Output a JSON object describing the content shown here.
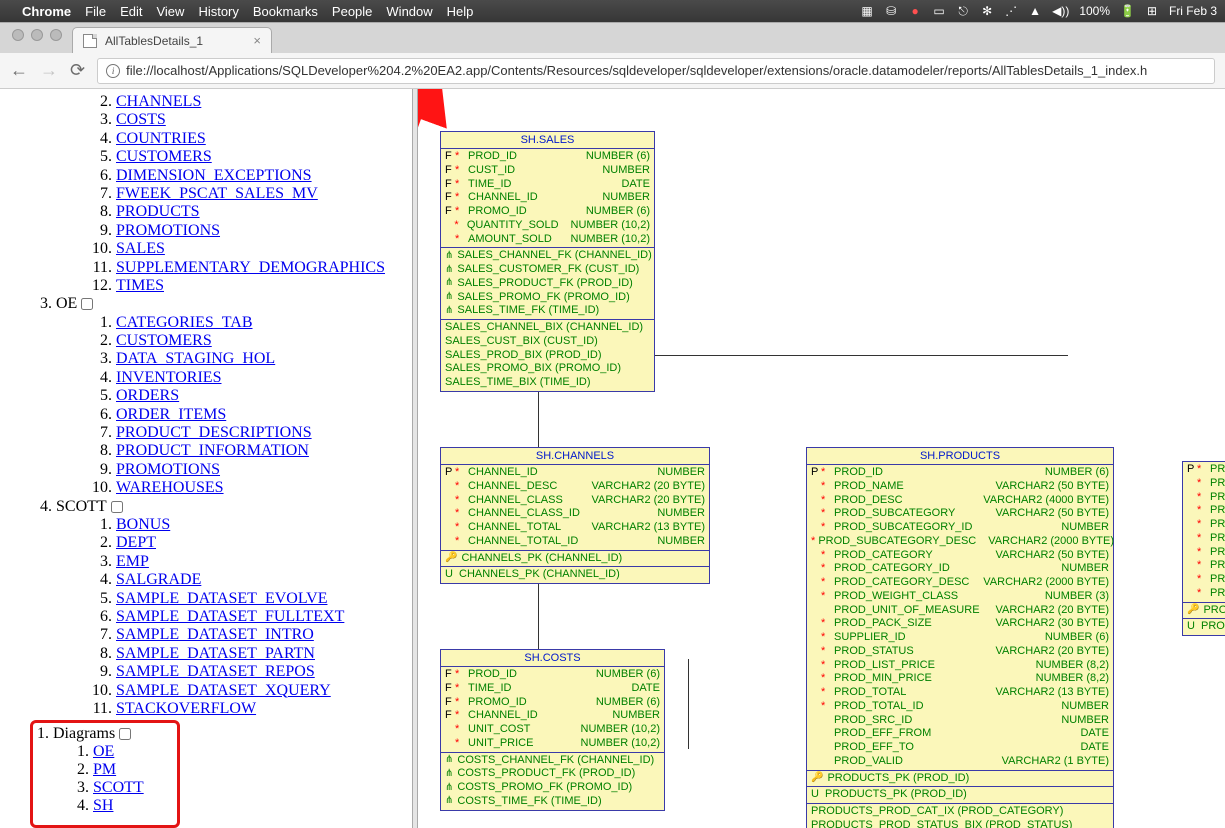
{
  "menubar": {
    "app": "Chrome",
    "items": [
      "File",
      "Edit",
      "View",
      "History",
      "Bookmarks",
      "People",
      "Window",
      "Help"
    ],
    "right": {
      "battery": "100%",
      "battery_icon": "⚡",
      "date": "Fri Feb 3",
      "sound": "◀))"
    }
  },
  "tab": {
    "title": "AllTablesDetails_1"
  },
  "url": "file://localhost/Applications/SQLDeveloper%204.2%20EA2.app/Contents/Resources/sqldeveloper/sqldeveloper/extensions/oracle.datamodeler/reports/AllTablesDetails_1_index.h",
  "nav": {
    "start_index": 2,
    "first_items": [
      "CHANNELS",
      "COSTS",
      "COUNTRIES",
      "CUSTOMERS",
      "DIMENSION_EXCEPTIONS",
      "FWEEK_PSCAT_SALES_MV",
      "PRODUCTS",
      "PROMOTIONS",
      "SALES",
      "SUPPLEMENTARY_DEMOGRAPHICS",
      "TIMES"
    ],
    "schemas": [
      {
        "num": "3",
        "name": "OE",
        "items": [
          "CATEGORIES_TAB",
          "CUSTOMERS",
          "DATA_STAGING_HOL",
          "INVENTORIES",
          "ORDERS",
          "ORDER_ITEMS",
          "PRODUCT_DESCRIPTIONS",
          "PRODUCT_INFORMATION",
          "PROMOTIONS",
          "WAREHOUSES"
        ]
      },
      {
        "num": "4",
        "name": "SCOTT",
        "items": [
          "BONUS",
          "DEPT",
          "EMP",
          "SALGRADE",
          "SAMPLE_DATASET_EVOLVE",
          "SAMPLE_DATASET_FULLTEXT",
          "SAMPLE_DATASET_INTRO",
          "SAMPLE_DATASET_PARTN",
          "SAMPLE_DATASET_REPOS",
          "SAMPLE_DATASET_XQUERY",
          "STACKOVERFLOW"
        ]
      }
    ],
    "diagrams": {
      "label": "Diagrams",
      "items": [
        "OE",
        "PM",
        "SCOTT",
        "SH"
      ]
    }
  },
  "diagram": {
    "label": "SH",
    "tables": {
      "sales": {
        "title": "SH.SALES",
        "cols": [
          {
            "f": "F",
            "s": "*",
            "n": "PROD_ID",
            "t": "NUMBER (6)"
          },
          {
            "f": "F",
            "s": "*",
            "n": "CUST_ID",
            "t": "NUMBER"
          },
          {
            "f": "F",
            "s": "*",
            "n": "TIME_ID",
            "t": "DATE"
          },
          {
            "f": "F",
            "s": "*",
            "n": "CHANNEL_ID",
            "t": "NUMBER"
          },
          {
            "f": "F",
            "s": "*",
            "n": "PROMO_ID",
            "t": "NUMBER (6)"
          },
          {
            "f": "",
            "s": "*",
            "n": "QUANTITY_SOLD",
            "t": "NUMBER (10,2)"
          },
          {
            "f": "",
            "s": "*",
            "n": "AMOUNT_SOLD",
            "t": "NUMBER (10,2)"
          }
        ],
        "fks": [
          "SALES_CHANNEL_FK (CHANNEL_ID)",
          "SALES_CUSTOMER_FK (CUST_ID)",
          "SALES_PRODUCT_FK (PROD_ID)",
          "SALES_PROMO_FK (PROMO_ID)",
          "SALES_TIME_FK (TIME_ID)"
        ],
        "idx": [
          "SALES_CHANNEL_BIX (CHANNEL_ID)",
          "SALES_CUST_BIX (CUST_ID)",
          "SALES_PROD_BIX (PROD_ID)",
          "SALES_PROMO_BIX (PROMO_ID)",
          "SALES_TIME_BIX (TIME_ID)"
        ]
      },
      "channels": {
        "title": "SH.CHANNELS",
        "cols": [
          {
            "f": "P",
            "s": "*",
            "n": "CHANNEL_ID",
            "t": "NUMBER"
          },
          {
            "f": "",
            "s": "*",
            "n": "CHANNEL_DESC",
            "t": "VARCHAR2 (20 BYTE)"
          },
          {
            "f": "",
            "s": "*",
            "n": "CHANNEL_CLASS",
            "t": "VARCHAR2 (20 BYTE)"
          },
          {
            "f": "",
            "s": "*",
            "n": "CHANNEL_CLASS_ID",
            "t": "NUMBER"
          },
          {
            "f": "",
            "s": "*",
            "n": "CHANNEL_TOTAL",
            "t": "VARCHAR2 (13 BYTE)"
          },
          {
            "f": "",
            "s": "*",
            "n": "CHANNEL_TOTAL_ID",
            "t": "NUMBER"
          }
        ],
        "pk": [
          "CHANNELS_PK (CHANNEL_ID)"
        ],
        "uk": [
          "CHANNELS_PK (CHANNEL_ID)"
        ]
      },
      "costs": {
        "title": "SH.COSTS",
        "cols": [
          {
            "f": "F",
            "s": "*",
            "n": "PROD_ID",
            "t": "NUMBER (6)"
          },
          {
            "f": "F",
            "s": "*",
            "n": "TIME_ID",
            "t": "DATE"
          },
          {
            "f": "F",
            "s": "*",
            "n": "PROMO_ID",
            "t": "NUMBER (6)"
          },
          {
            "f": "F",
            "s": "*",
            "n": "CHANNEL_ID",
            "t": "NUMBER"
          },
          {
            "f": "",
            "s": "*",
            "n": "UNIT_COST",
            "t": "NUMBER (10,2)"
          },
          {
            "f": "",
            "s": "*",
            "n": "UNIT_PRICE",
            "t": "NUMBER (10,2)"
          }
        ],
        "fks": [
          "COSTS_CHANNEL_FK (CHANNEL_ID)",
          "COSTS_PRODUCT_FK (PROD_ID)",
          "COSTS_PROMO_FK (PROMO_ID)",
          "COSTS_TIME_FK (TIME_ID)"
        ]
      },
      "products": {
        "title": "SH.PRODUCTS",
        "cols": [
          {
            "f": "P",
            "s": "*",
            "n": "PROD_ID",
            "t": "NUMBER (6)"
          },
          {
            "f": "",
            "s": "*",
            "n": "PROD_NAME",
            "t": "VARCHAR2 (50 BYTE)"
          },
          {
            "f": "",
            "s": "*",
            "n": "PROD_DESC",
            "t": "VARCHAR2 (4000 BYTE)"
          },
          {
            "f": "",
            "s": "*",
            "n": "PROD_SUBCATEGORY",
            "t": "VARCHAR2 (50 BYTE)"
          },
          {
            "f": "",
            "s": "*",
            "n": "PROD_SUBCATEGORY_ID",
            "t": "NUMBER"
          },
          {
            "f": "",
            "s": "*",
            "n": "PROD_SUBCATEGORY_DESC",
            "t": "VARCHAR2 (2000 BYTE)"
          },
          {
            "f": "",
            "s": "*",
            "n": "PROD_CATEGORY",
            "t": "VARCHAR2 (50 BYTE)"
          },
          {
            "f": "",
            "s": "*",
            "n": "PROD_CATEGORY_ID",
            "t": "NUMBER"
          },
          {
            "f": "",
            "s": "*",
            "n": "PROD_CATEGORY_DESC",
            "t": "VARCHAR2 (2000 BYTE)"
          },
          {
            "f": "",
            "s": "*",
            "n": "PROD_WEIGHT_CLASS",
            "t": "NUMBER (3)"
          },
          {
            "f": "",
            "s": "",
            "n": "PROD_UNIT_OF_MEASURE",
            "t": "VARCHAR2 (20 BYTE)"
          },
          {
            "f": "",
            "s": "*",
            "n": "PROD_PACK_SIZE",
            "t": "VARCHAR2 (30 BYTE)"
          },
          {
            "f": "",
            "s": "*",
            "n": "SUPPLIER_ID",
            "t": "NUMBER (6)"
          },
          {
            "f": "",
            "s": "*",
            "n": "PROD_STATUS",
            "t": "VARCHAR2 (20 BYTE)"
          },
          {
            "f": "",
            "s": "*",
            "n": "PROD_LIST_PRICE",
            "t": "NUMBER (8,2)"
          },
          {
            "f": "",
            "s": "*",
            "n": "PROD_MIN_PRICE",
            "t": "NUMBER (8,2)"
          },
          {
            "f": "",
            "s": "*",
            "n": "PROD_TOTAL",
            "t": "VARCHAR2 (13 BYTE)"
          },
          {
            "f": "",
            "s": "*",
            "n": "PROD_TOTAL_ID",
            "t": "NUMBER"
          },
          {
            "f": "",
            "s": "",
            "n": "PROD_SRC_ID",
            "t": "NUMBER"
          },
          {
            "f": "",
            "s": "",
            "n": "PROD_EFF_FROM",
            "t": "DATE"
          },
          {
            "f": "",
            "s": "",
            "n": "PROD_EFF_TO",
            "t": "DATE"
          },
          {
            "f": "",
            "s": "",
            "n": "PROD_VALID",
            "t": "VARCHAR2 (1 BYTE)"
          }
        ],
        "pk": [
          "PRODUCTS_PK (PROD_ID)"
        ],
        "uk": [
          "PRODUCTS_PK (PROD_ID)"
        ],
        "idx": [
          "PRODUCTS_PROD_CAT_IX (PROD_CATEGORY)",
          "PRODUCTS_PROD_STATUS_BIX (PROD_STATUS)"
        ]
      },
      "edge": {
        "cols": [
          {
            "f": "P",
            "s": "*",
            "n": "PR"
          },
          {
            "f": "",
            "s": "*",
            "n": "PR"
          },
          {
            "f": "",
            "s": "*",
            "n": "PR"
          },
          {
            "f": "",
            "s": "*",
            "n": "PR"
          },
          {
            "f": "",
            "s": "*",
            "n": "PR"
          },
          {
            "f": "",
            "s": "*",
            "n": "PR"
          },
          {
            "f": "",
            "s": "*",
            "n": "PR"
          },
          {
            "f": "",
            "s": "*",
            "n": "PR"
          },
          {
            "f": "",
            "s": "*",
            "n": "PR"
          },
          {
            "f": "",
            "s": "*",
            "n": "PR"
          }
        ],
        "pk": [
          "PRO"
        ],
        "uk": [
          "PRO"
        ]
      }
    }
  }
}
